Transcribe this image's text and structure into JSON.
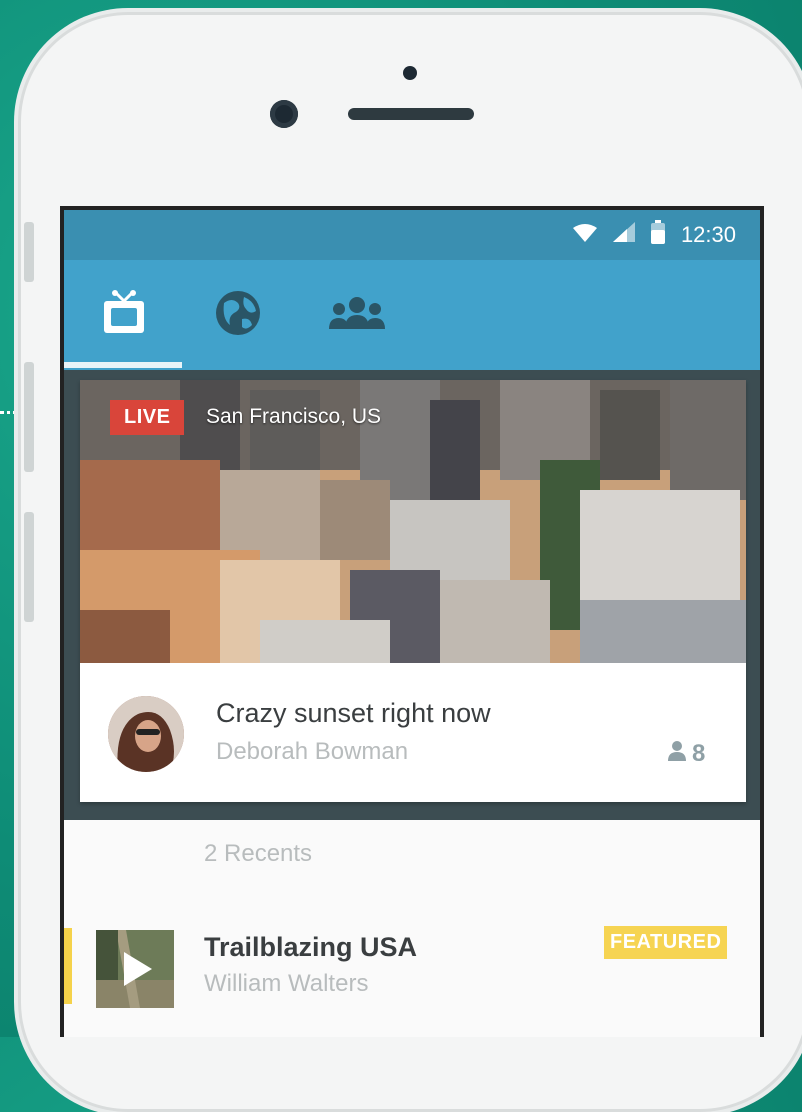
{
  "status_bar": {
    "time": "12:30"
  },
  "tabs": [
    {
      "name": "tv",
      "icon": "tv-icon",
      "active": true
    },
    {
      "name": "world",
      "icon": "globe-icon",
      "active": false
    },
    {
      "name": "people",
      "icon": "people-icon",
      "active": false
    }
  ],
  "live_card": {
    "badge": "LIVE",
    "location": "San Francisco, US",
    "title": "Crazy sunset right now",
    "author": "Deborah Bowman",
    "viewers": "8"
  },
  "recents": {
    "count_label": "2 Recents",
    "items": [
      {
        "title": "Trailblazing USA",
        "author": "William Walters",
        "badge": "FEATURED"
      }
    ]
  },
  "colors": {
    "accent_bar": "#41a2cb",
    "status_bar": "#3a8fb1",
    "live_red": "#d9453a",
    "featured_yellow": "#f6d452"
  }
}
